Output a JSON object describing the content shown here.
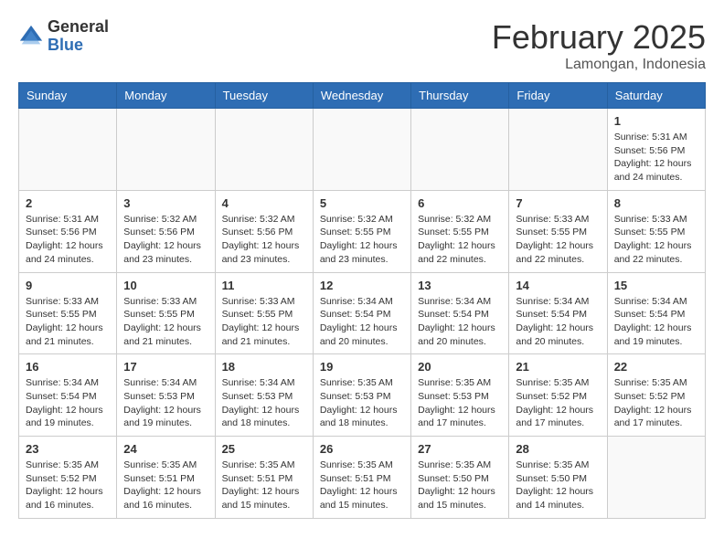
{
  "header": {
    "logo_general": "General",
    "logo_blue": "Blue",
    "month_title": "February 2025",
    "location": "Lamongan, Indonesia"
  },
  "weekdays": [
    "Sunday",
    "Monday",
    "Tuesday",
    "Wednesday",
    "Thursday",
    "Friday",
    "Saturday"
  ],
  "weeks": [
    [
      {
        "day": "",
        "info": ""
      },
      {
        "day": "",
        "info": ""
      },
      {
        "day": "",
        "info": ""
      },
      {
        "day": "",
        "info": ""
      },
      {
        "day": "",
        "info": ""
      },
      {
        "day": "",
        "info": ""
      },
      {
        "day": "1",
        "info": "Sunrise: 5:31 AM\nSunset: 5:56 PM\nDaylight: 12 hours\nand 24 minutes."
      }
    ],
    [
      {
        "day": "2",
        "info": "Sunrise: 5:31 AM\nSunset: 5:56 PM\nDaylight: 12 hours\nand 24 minutes."
      },
      {
        "day": "3",
        "info": "Sunrise: 5:32 AM\nSunset: 5:56 PM\nDaylight: 12 hours\nand 23 minutes."
      },
      {
        "day": "4",
        "info": "Sunrise: 5:32 AM\nSunset: 5:56 PM\nDaylight: 12 hours\nand 23 minutes."
      },
      {
        "day": "5",
        "info": "Sunrise: 5:32 AM\nSunset: 5:55 PM\nDaylight: 12 hours\nand 23 minutes."
      },
      {
        "day": "6",
        "info": "Sunrise: 5:32 AM\nSunset: 5:55 PM\nDaylight: 12 hours\nand 22 minutes."
      },
      {
        "day": "7",
        "info": "Sunrise: 5:33 AM\nSunset: 5:55 PM\nDaylight: 12 hours\nand 22 minutes."
      },
      {
        "day": "8",
        "info": "Sunrise: 5:33 AM\nSunset: 5:55 PM\nDaylight: 12 hours\nand 22 minutes."
      }
    ],
    [
      {
        "day": "9",
        "info": "Sunrise: 5:33 AM\nSunset: 5:55 PM\nDaylight: 12 hours\nand 21 minutes."
      },
      {
        "day": "10",
        "info": "Sunrise: 5:33 AM\nSunset: 5:55 PM\nDaylight: 12 hours\nand 21 minutes."
      },
      {
        "day": "11",
        "info": "Sunrise: 5:33 AM\nSunset: 5:55 PM\nDaylight: 12 hours\nand 21 minutes."
      },
      {
        "day": "12",
        "info": "Sunrise: 5:34 AM\nSunset: 5:54 PM\nDaylight: 12 hours\nand 20 minutes."
      },
      {
        "day": "13",
        "info": "Sunrise: 5:34 AM\nSunset: 5:54 PM\nDaylight: 12 hours\nand 20 minutes."
      },
      {
        "day": "14",
        "info": "Sunrise: 5:34 AM\nSunset: 5:54 PM\nDaylight: 12 hours\nand 20 minutes."
      },
      {
        "day": "15",
        "info": "Sunrise: 5:34 AM\nSunset: 5:54 PM\nDaylight: 12 hours\nand 19 minutes."
      }
    ],
    [
      {
        "day": "16",
        "info": "Sunrise: 5:34 AM\nSunset: 5:54 PM\nDaylight: 12 hours\nand 19 minutes."
      },
      {
        "day": "17",
        "info": "Sunrise: 5:34 AM\nSunset: 5:53 PM\nDaylight: 12 hours\nand 19 minutes."
      },
      {
        "day": "18",
        "info": "Sunrise: 5:34 AM\nSunset: 5:53 PM\nDaylight: 12 hours\nand 18 minutes."
      },
      {
        "day": "19",
        "info": "Sunrise: 5:35 AM\nSunset: 5:53 PM\nDaylight: 12 hours\nand 18 minutes."
      },
      {
        "day": "20",
        "info": "Sunrise: 5:35 AM\nSunset: 5:53 PM\nDaylight: 12 hours\nand 17 minutes."
      },
      {
        "day": "21",
        "info": "Sunrise: 5:35 AM\nSunset: 5:52 PM\nDaylight: 12 hours\nand 17 minutes."
      },
      {
        "day": "22",
        "info": "Sunrise: 5:35 AM\nSunset: 5:52 PM\nDaylight: 12 hours\nand 17 minutes."
      }
    ],
    [
      {
        "day": "23",
        "info": "Sunrise: 5:35 AM\nSunset: 5:52 PM\nDaylight: 12 hours\nand 16 minutes."
      },
      {
        "day": "24",
        "info": "Sunrise: 5:35 AM\nSunset: 5:51 PM\nDaylight: 12 hours\nand 16 minutes."
      },
      {
        "day": "25",
        "info": "Sunrise: 5:35 AM\nSunset: 5:51 PM\nDaylight: 12 hours\nand 15 minutes."
      },
      {
        "day": "26",
        "info": "Sunrise: 5:35 AM\nSunset: 5:51 PM\nDaylight: 12 hours\nand 15 minutes."
      },
      {
        "day": "27",
        "info": "Sunrise: 5:35 AM\nSunset: 5:50 PM\nDaylight: 12 hours\nand 15 minutes."
      },
      {
        "day": "28",
        "info": "Sunrise: 5:35 AM\nSunset: 5:50 PM\nDaylight: 12 hours\nand 14 minutes."
      },
      {
        "day": "",
        "info": ""
      }
    ]
  ]
}
